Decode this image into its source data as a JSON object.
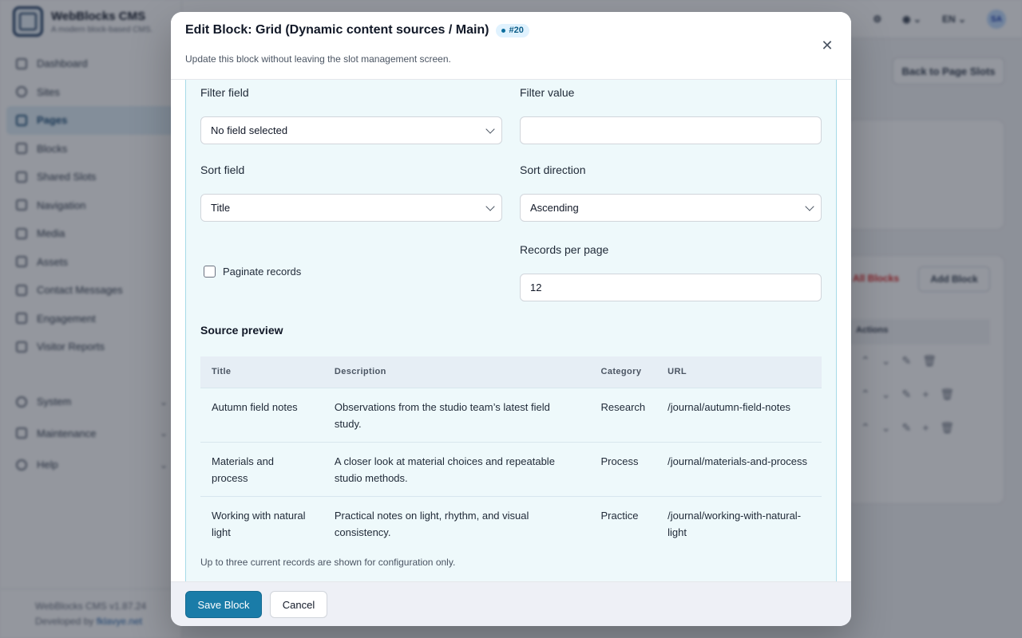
{
  "app": {
    "name": "WebBlocks CMS",
    "tagline": "A modern block-based CMS.",
    "nav": [
      {
        "label": "Dashboard",
        "icon": "grid-icon",
        "active": false
      },
      {
        "label": "Sites",
        "icon": "globe-icon",
        "active": false
      },
      {
        "label": "Pages",
        "icon": "document-icon",
        "active": true
      },
      {
        "label": "Blocks",
        "icon": "cube-icon",
        "active": false
      },
      {
        "label": "Shared Slots",
        "icon": "layers-icon",
        "active": false
      },
      {
        "label": "Navigation",
        "icon": "menu-icon",
        "active": false
      },
      {
        "label": "Media",
        "icon": "image-icon",
        "active": false
      },
      {
        "label": "Assets",
        "icon": "code-icon",
        "active": false
      },
      {
        "label": "Contact Messages",
        "icon": "mail-icon",
        "active": false
      },
      {
        "label": "Engagement",
        "icon": "star-icon",
        "active": false
      },
      {
        "label": "Visitor Reports",
        "icon": "bar-chart-icon",
        "active": false
      }
    ],
    "nav_groups": [
      {
        "label": "System",
        "icon": "gear-icon"
      },
      {
        "label": "Maintenance",
        "icon": "wrench-icon"
      },
      {
        "label": "Help",
        "icon": "help-icon"
      }
    ],
    "version": "WebBlocks CMS v1.87.24",
    "developed_by_prefix": "Developed by",
    "developer": "fklavye.net",
    "language": "EN",
    "user_initials": "SA",
    "back_button": "Back to Page Slots",
    "remove_all": "All Blocks",
    "add_block": "Add Block",
    "actions_header": "Actions"
  },
  "modal": {
    "title": "Edit Block: Grid (Dynamic content sources / Main)",
    "badge": "#20",
    "subtitle": "Update this block without leaving the slot management screen.",
    "filter_field": {
      "label": "Filter field",
      "value": "No field selected"
    },
    "filter_value": {
      "label": "Filter value",
      "value": ""
    },
    "sort_field": {
      "label": "Sort field",
      "value": "Title"
    },
    "sort_direction": {
      "label": "Sort direction",
      "value": "Ascending"
    },
    "paginate": {
      "label": "Paginate records",
      "checked": false
    },
    "records_per_page": {
      "label": "Records per page",
      "value": "12"
    },
    "preview": {
      "title": "Source preview",
      "columns": [
        "Title",
        "Description",
        "Category",
        "URL"
      ],
      "rows": [
        [
          "Autumn field notes",
          "Observations from the studio team’s latest field study.",
          "Research",
          "/journal/autumn-field-notes"
        ],
        [
          "Materials and process",
          "A closer look at material choices and repeatable studio methods.",
          "Process",
          "/journal/materials-and-process"
        ],
        [
          "Working with natural light",
          "Practical notes on light, rhythm, and visual consistency.",
          "Practice",
          "/journal/working-with-natural-light"
        ]
      ],
      "note": "Up to three current records are shown for configuration only."
    },
    "save_label": "Save Block",
    "cancel_label": "Cancel"
  }
}
